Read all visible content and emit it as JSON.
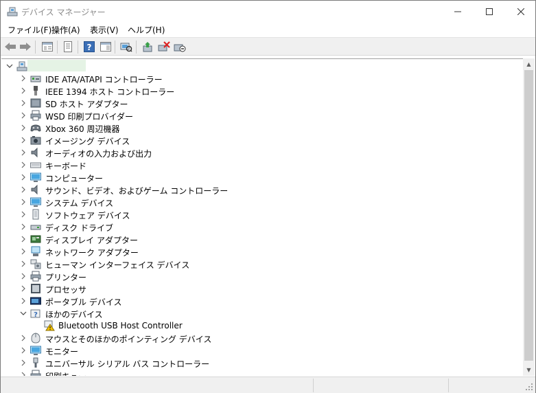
{
  "window": {
    "title": "デバイス マネージャー"
  },
  "menu": {
    "items": [
      {
        "label": "ファイル(F)"
      },
      {
        "label": "操作(A)"
      },
      {
        "label": "表示(V)"
      },
      {
        "label": "ヘルプ(H)"
      }
    ]
  },
  "toolbar": {
    "buttons": [
      "back-arrow-icon",
      "forward-arrow-icon",
      "properties-icon",
      "tree-view-icon",
      "help-icon",
      "details-icon",
      "scan-hardware-icon",
      "update-driver-icon",
      "uninstall-device-icon",
      "disable-device-icon"
    ]
  },
  "tree": {
    "root_label": "",
    "items": [
      {
        "label": "IDE ATA/ATAPI コントローラー",
        "icon": "ide-controller-icon"
      },
      {
        "label": "IEEE 1394 ホスト コントローラー",
        "icon": "ieee1394-icon"
      },
      {
        "label": "SD ホスト アダプター",
        "icon": "sd-host-icon"
      },
      {
        "label": "WSD 印刷プロバイダー",
        "icon": "printer-icon"
      },
      {
        "label": "Xbox 360 周辺機器",
        "icon": "gamepad-icon"
      },
      {
        "label": "イメージング デバイス",
        "icon": "camera-icon"
      },
      {
        "label": "オーディオの入力および出力",
        "icon": "speaker-icon"
      },
      {
        "label": "キーボード",
        "icon": "keyboard-icon"
      },
      {
        "label": "コンピューター",
        "icon": "monitor-icon"
      },
      {
        "label": "サウンド、ビデオ、およびゲーム コントローラー",
        "icon": "speaker-icon"
      },
      {
        "label": "システム デバイス",
        "icon": "monitor-icon"
      },
      {
        "label": "ソフトウェア デバイス",
        "icon": "software-device-icon"
      },
      {
        "label": "ディスク ドライブ",
        "icon": "disk-drive-icon"
      },
      {
        "label": "ディスプレイ アダプター",
        "icon": "display-adapter-icon"
      },
      {
        "label": "ネットワーク アダプター",
        "icon": "network-adapter-icon"
      },
      {
        "label": "ヒューマン インターフェイス デバイス",
        "icon": "hid-icon"
      },
      {
        "label": "プリンター",
        "icon": "printer-icon"
      },
      {
        "label": "プロセッサ",
        "icon": "processor-icon"
      },
      {
        "label": "ポータブル デバイス",
        "icon": "portable-device-icon"
      },
      {
        "label": "ほかのデバイス",
        "icon": "unknown-device-icon",
        "expanded": true
      },
      {
        "label": "Bluetooth USB Host Controller",
        "icon": "warning-device-icon",
        "child": true
      },
      {
        "label": "マウスとそのほかのポインティング デバイス",
        "icon": "mouse-icon"
      },
      {
        "label": "モニター",
        "icon": "monitor-icon"
      },
      {
        "label": "ユニバーサル シリアル バス コントローラー",
        "icon": "usb-icon"
      },
      {
        "label": "印刷キュー",
        "icon": "printer-icon"
      }
    ]
  },
  "colors": {
    "selection": "#e5f3e5",
    "title_text": "#8a8a8a",
    "toolbar_bg": "#f0f0f0"
  }
}
